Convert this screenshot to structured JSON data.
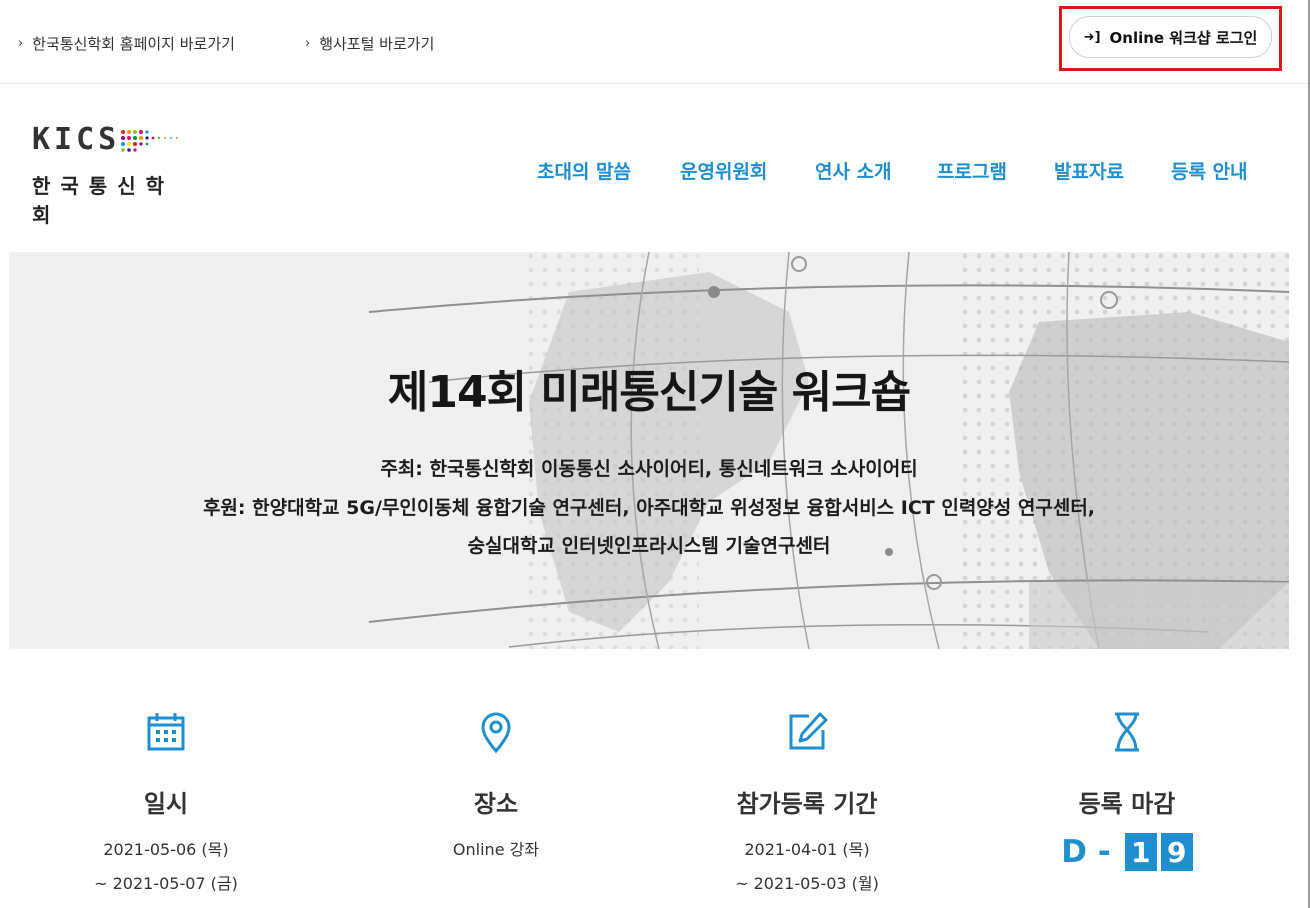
{
  "topbar": {
    "link1": "한국통신학회 홈페이지 바로가기",
    "link2": "행사포털 바로가기",
    "login_label": "Online 워크샵 로그인"
  },
  "logo": {
    "en": "KICS",
    "ko": "한국통신학회"
  },
  "nav": [
    {
      "label": "초대의 말씀"
    },
    {
      "label": "운영위원회"
    },
    {
      "label": "연사 소개"
    },
    {
      "label": "프로그램"
    },
    {
      "label": "발표자료"
    },
    {
      "label": "등록 안내"
    }
  ],
  "hero": {
    "title": "제14회 미래통신기술 워크숍",
    "line1": "주최: 한국통신학회 이동통신 소사이어티, 통신네트워크 소사이어티",
    "line2": "후원: 한양대학교 5G/무인이동체 융합기술 연구센터, 아주대학교 위성정보 융합서비스 ICT 인력양성 연구센터,",
    "line3": "숭실대학교 인터넷인프라시스템 기술연구센터"
  },
  "info": {
    "date": {
      "label": "일시",
      "start": "2021-05-06 (목)",
      "end": "~ 2021-05-07 (금)",
      "icon": "calendar-icon"
    },
    "place": {
      "label": "장소",
      "value": "Online 강좌",
      "icon": "location-pin-icon"
    },
    "registration": {
      "label": "참가등록 기간",
      "start": "2021-04-01 (목)",
      "end": "~ 2021-05-03 (월)",
      "icon": "edit-icon"
    },
    "deadline": {
      "label": "등록 마감",
      "prefix": "D -",
      "digits": [
        "1",
        "9"
      ],
      "icon": "hourglass-icon"
    }
  },
  "colors": {
    "accent": "#1f8fcf",
    "highlight_frame": "#d51a1a",
    "hero_bg": "#f0f0f0"
  }
}
